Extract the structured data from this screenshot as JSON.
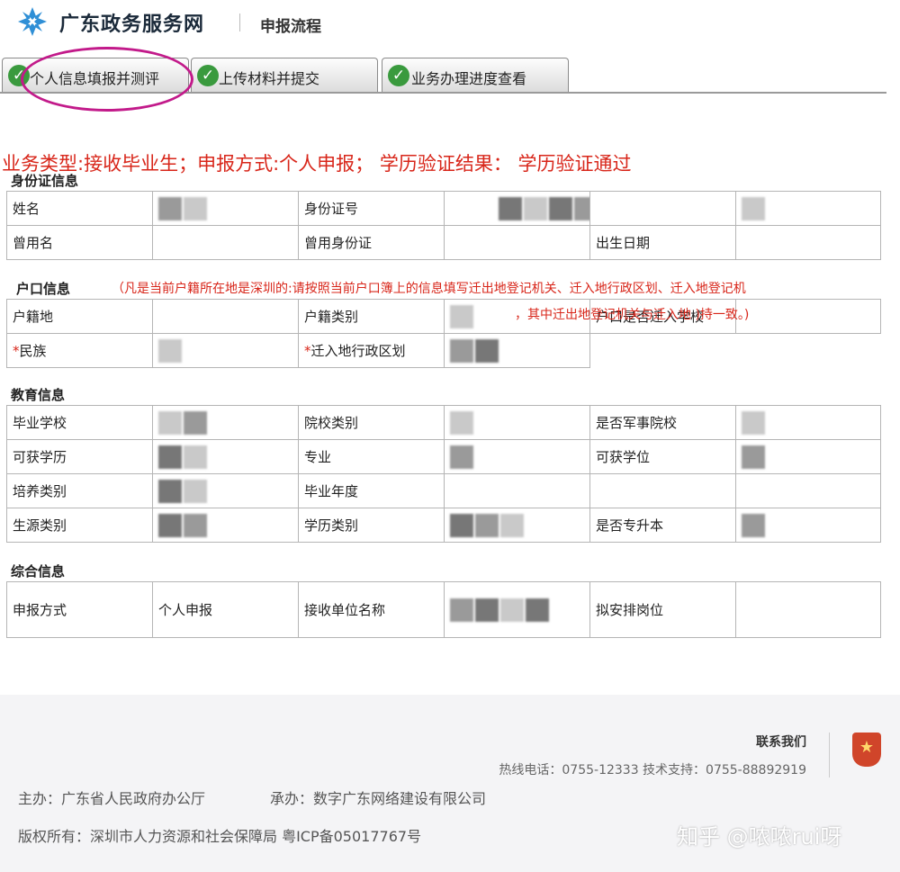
{
  "header": {
    "site_title": "广东政务服务网",
    "breadcrumb": "申报流程"
  },
  "tabs": [
    {
      "label": "个人信息填报并测评",
      "status": "done"
    },
    {
      "label": "上传材料并提交",
      "status": "done"
    },
    {
      "label": "业务办理进度查看",
      "status": "done"
    }
  ],
  "summary": "业务类型:接收毕业生；申报方式:个人申报；  学历验证结果：  学历验证通过",
  "sections": {
    "identity": "身份证信息",
    "household": "户口信息",
    "education": "教育信息",
    "general": "综合信息"
  },
  "identity": {
    "name_label": "姓名",
    "id_label": "身份证号",
    "former_name_label": "曾用名",
    "former_id_label": "曾用身份证",
    "birth_label": "出生日期"
  },
  "household": {
    "note": "（凡是当前户籍所在地是深圳的:请按照当前户口簿上的信息填写迁出地登记机关、迁入地行政区划、迁入地登记机",
    "note2": "，其中迁出地登记机关与迁入地               )持一致。)",
    "place_label": "户籍地",
    "type_label": "户籍类别",
    "school_move_label": "户口是否迁入学校",
    "ethnicity_label": "民族",
    "district_label": "迁入地行政区划",
    "required_mark": "*"
  },
  "education": {
    "school_label": "毕业学校",
    "school_type_label": "院校类别",
    "military_label": "是否军事院校",
    "degree_label": "可获学历",
    "major_label": "专业",
    "academic_degree_label": "可获学位",
    "training_label": "培养类别",
    "grad_year_label": "毕业年度",
    "source_label": "生源类别",
    "edu_type_label": "学历类别",
    "upgrade_label": "是否专升本"
  },
  "general": {
    "method_label": "申报方式",
    "method_value": "个人申报",
    "employer_label": "接收单位名称",
    "post_label": "拟安排岗位"
  },
  "footer": {
    "contact": "联系我们",
    "hotline": "热线电话：0755-12333 技术支持：0755-88892919",
    "host": "主办：广东省人民政府办公厅",
    "undertake": "承办：数字广东网络建设有限公司",
    "copyright": "版权所有：深圳市人力资源和社会保障局   粤ICP备05017767号",
    "watermark": "知乎 @哝哝rui呀"
  },
  "colors": {
    "accent_red": "#d8261a",
    "check_green": "#3a9a3e",
    "annotation_magenta": "#c21a8a"
  }
}
